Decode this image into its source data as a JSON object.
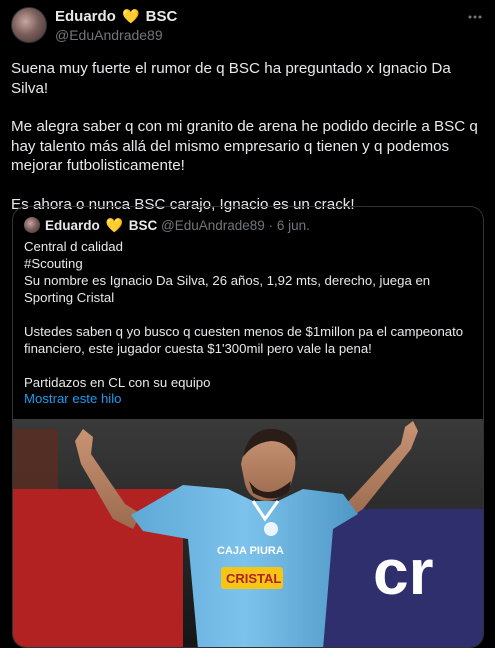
{
  "tweet": {
    "author_name": "Eduardo",
    "author_heart": "💛",
    "author_suffix": "BSC",
    "handle": "@EduAndrade89",
    "more_icon": "more-dots-icon",
    "paragraphs": [
      "Suena muy fuerte el rumor de q BSC ha preguntado x Ignacio Da Silva!",
      "Me alegra saber q con mi granito de arena he podido decirle a BSC q hay talento más allá del mismo empresario q tienen y q podemos mejorar futbolisticamente!",
      "Es ahora o nunca BSC carajo, Ignacio es un crack!"
    ]
  },
  "quote": {
    "author_name": "Eduardo",
    "author_heart": "💛",
    "author_suffix": "BSC",
    "handle": "@EduAndrade89",
    "separator": "·",
    "date": "6 jun.",
    "lines_block1": [
      "Central d calidad",
      "#Scouting",
      "Su nombre es Ignacio Da Silva, 26 años, 1,92 mts, derecho, juega en Sporting Cristal"
    ],
    "block2": "Ustedes saben q yo busco q cuesten menos de $1millon pa el campeonato financiero, este jugador cuesta $1'300mil pero vale la pena!",
    "block3": "Partidazos en CL con su equipo",
    "show_thread": "Mostrar este hilo"
  },
  "photo": {
    "sponsor_text": "CAJA PIURA",
    "shirt_brand": "CRISTAL",
    "background_text": "cr"
  },
  "colors": {
    "background": "#000000",
    "text": "#e7e9ea",
    "secondary": "#71767b",
    "link": "#1d9bf0",
    "border": "#2f3336",
    "jersey": "#6cb7e3"
  }
}
